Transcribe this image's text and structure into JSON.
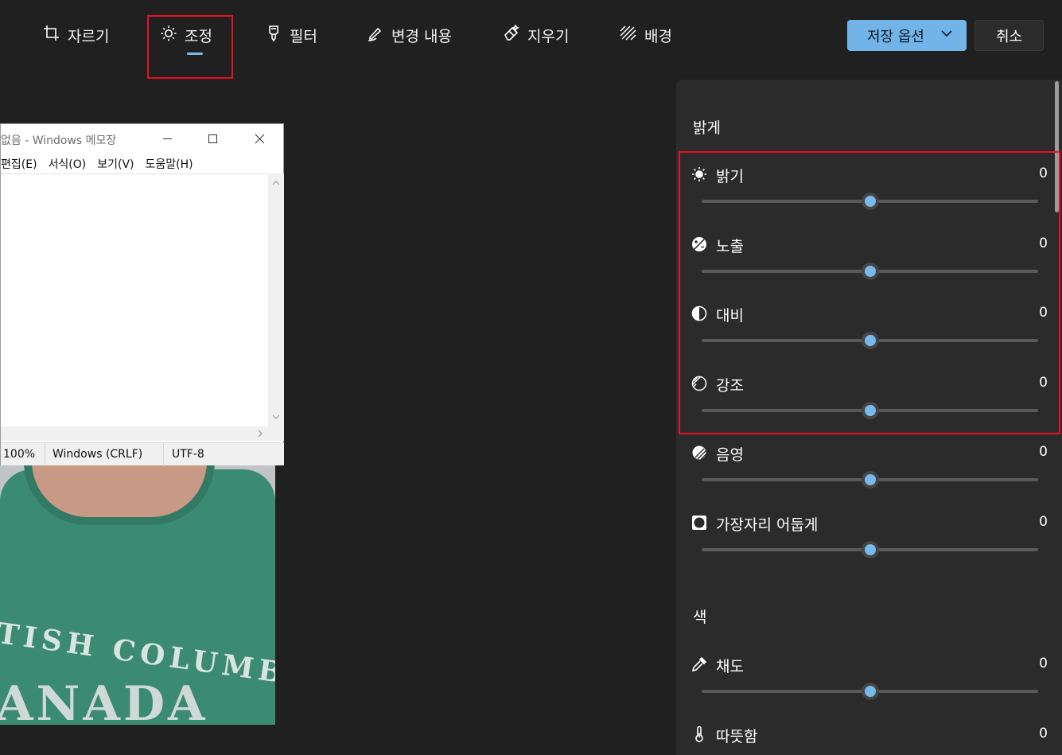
{
  "toolbar": {
    "tabs": [
      {
        "label": "자르기",
        "icon": "crop-icon"
      },
      {
        "label": "조정",
        "icon": "brightness-icon",
        "active": true
      },
      {
        "label": "필터",
        "icon": "filter-icon"
      },
      {
        "label": "변경 내용",
        "icon": "markup-pen-icon"
      },
      {
        "label": "지우기",
        "icon": "eraser-icon"
      },
      {
        "label": "배경",
        "icon": "background-icon"
      }
    ],
    "save_label": "저장 옵션",
    "cancel_label": "취소"
  },
  "notepad": {
    "title": "없음 - Windows 메모장",
    "menu": [
      "편집(E)",
      "서식(O)",
      "보기(V)",
      "도움말(H)"
    ],
    "status": {
      "zoom": "100%",
      "line_ending": "Windows (CRLF)",
      "encoding": "UTF-8"
    }
  },
  "photo": {
    "print_line1": "TISH COLUMBIA",
    "print_line2": "ANADA"
  },
  "panel": {
    "light_title": "밝게",
    "light_items": [
      {
        "label": "밝기",
        "value": "0",
        "icon": "sun-icon",
        "level": 0.5
      },
      {
        "label": "노출",
        "value": "0",
        "icon": "exposure-icon",
        "level": 0.5
      },
      {
        "label": "대비",
        "value": "0",
        "icon": "contrast-icon",
        "level": 0.5
      },
      {
        "label": "강조",
        "value": "0",
        "icon": "highlights-icon",
        "level": 0.5
      },
      {
        "label": "음영",
        "value": "0",
        "icon": "shadows-icon",
        "level": 0.5
      },
      {
        "label": "가장자리 어둡게",
        "value": "0",
        "icon": "vignette-icon",
        "level": 0.5
      }
    ],
    "color_title": "색",
    "color_items": [
      {
        "label": "채도",
        "value": "0",
        "icon": "eyedropper-icon",
        "level": 0.5
      },
      {
        "label": "따뜻함",
        "value": "0",
        "icon": "thermometer-icon",
        "level": 0.5
      }
    ]
  },
  "colors": {
    "accent": "#72b4e8",
    "highlight_box": "#e81123",
    "panel_bg": "#2b2b2b",
    "app_bg": "#202020"
  }
}
